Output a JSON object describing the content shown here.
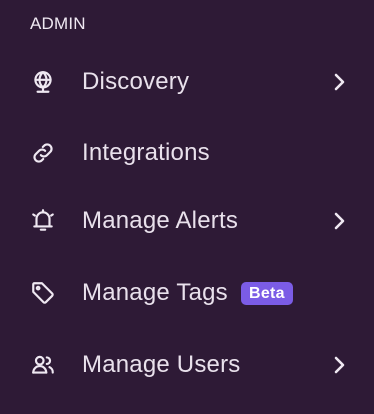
{
  "sidebar": {
    "section_title": "ADMIN",
    "items": [
      {
        "label": "Discovery",
        "icon": "globe-icon",
        "has_chevron": true
      },
      {
        "label": "Integrations",
        "icon": "link-icon",
        "has_chevron": false
      },
      {
        "label": "Manage Alerts",
        "icon": "bell-icon",
        "has_chevron": true
      },
      {
        "label": "Manage Tags",
        "icon": "tag-icon",
        "has_chevron": false,
        "badge": "Beta"
      },
      {
        "label": "Manage Users",
        "icon": "users-icon",
        "has_chevron": true
      }
    ]
  },
  "colors": {
    "background": "#2e1a36",
    "text": "#e9e1ec",
    "badge": "#7b5ce6"
  }
}
